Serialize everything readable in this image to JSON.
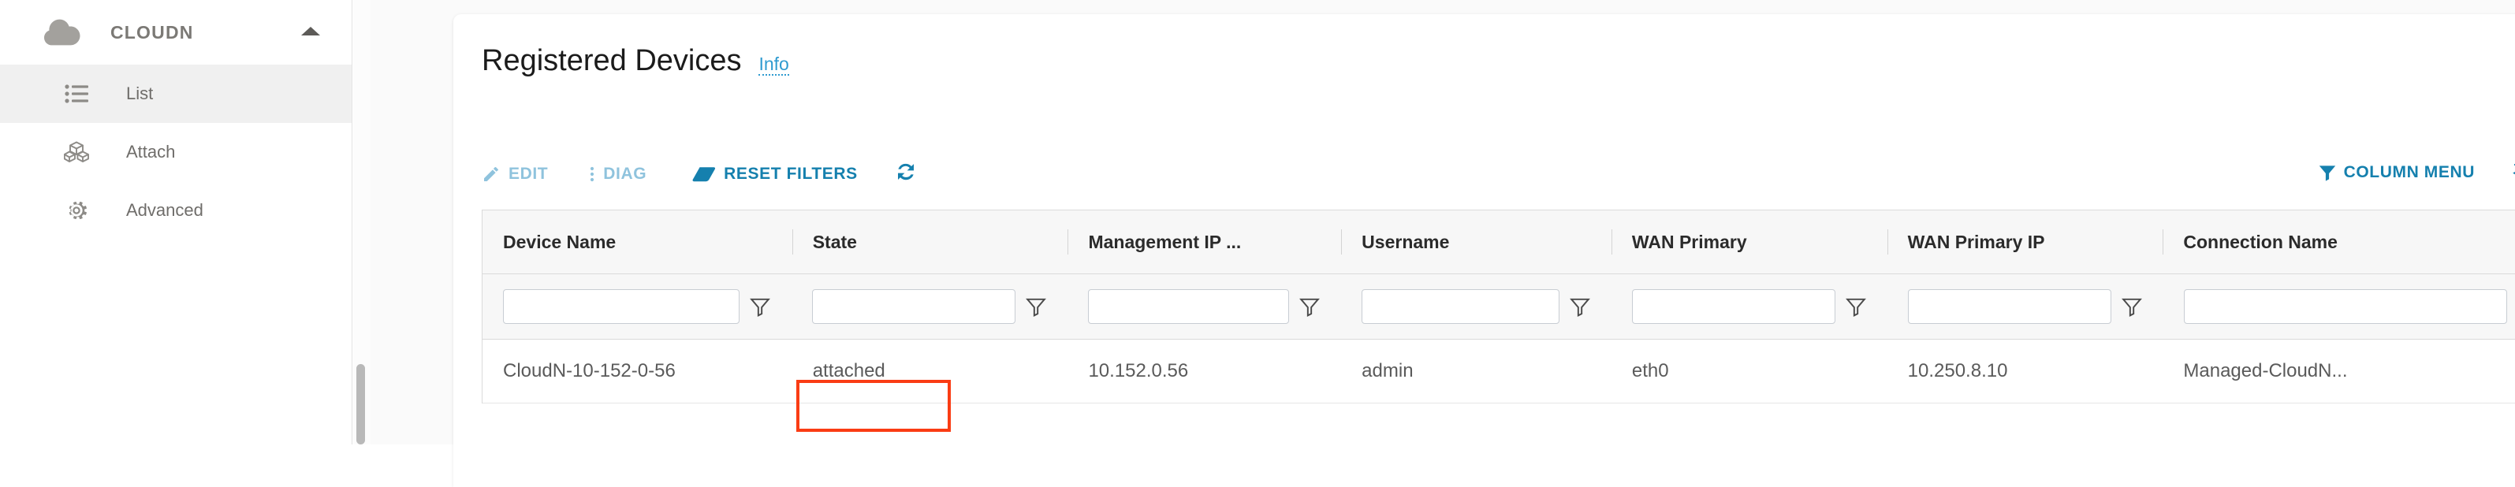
{
  "sidebar": {
    "brand": {
      "label": "CLOUDN",
      "icon": "cloud-icon",
      "collapse_icon": "chevron-up-icon"
    },
    "items": [
      {
        "label": "List",
        "icon": "list-icon",
        "active": true
      },
      {
        "label": "Attach",
        "icon": "cubes-icon",
        "active": false
      },
      {
        "label": "Advanced",
        "icon": "gear-icon",
        "active": false
      }
    ]
  },
  "main": {
    "title": "Registered Devices",
    "info_link": "Info",
    "toolbar": {
      "edit_label": "EDIT",
      "diag_label": "DIAG",
      "reset_filters_label": "RESET FILTERS",
      "refresh_icon": "refresh-icon",
      "column_menu_label": "COLUMN MENU",
      "column_menu_icon": "funnel-icon",
      "swap_columns_icon": "swap-arrows-icon"
    },
    "table": {
      "columns": [
        "Device Name",
        "State",
        "Management IP ...",
        "Username",
        "WAN Primary",
        "WAN Primary IP",
        "Connection Name"
      ],
      "filters": [
        {
          "value": "",
          "placeholder": "",
          "icon": "funnel-outline-icon"
        },
        {
          "value": "",
          "placeholder": "",
          "icon": "funnel-outline-icon"
        },
        {
          "value": "",
          "placeholder": "",
          "icon": "funnel-outline-icon"
        },
        {
          "value": "",
          "placeholder": "",
          "icon": "funnel-outline-icon"
        },
        {
          "value": "",
          "placeholder": "",
          "icon": "funnel-outline-icon"
        },
        {
          "value": "",
          "placeholder": "",
          "icon": "funnel-outline-icon"
        },
        {
          "value": "",
          "placeholder": "",
          "icon": "funnel-solid-icon"
        }
      ],
      "rows": [
        {
          "device_name": "CloudN-10-152-0-56",
          "state": "attached",
          "management_ip": "10.152.0.56",
          "username": "admin",
          "wan_primary": "eth0",
          "wan_primary_ip": "10.250.8.10",
          "connection_name": "Managed-CloudN..."
        }
      ]
    }
  },
  "colors": {
    "accent_blue": "#1580ae",
    "accent_blue_disabled": "#8fc3dd",
    "info_blue": "#2f9bd0",
    "annotation_red": "#fa3c14",
    "sidebar_active_bg": "#f0f0f0",
    "header_bg": "#f7f7f7"
  }
}
